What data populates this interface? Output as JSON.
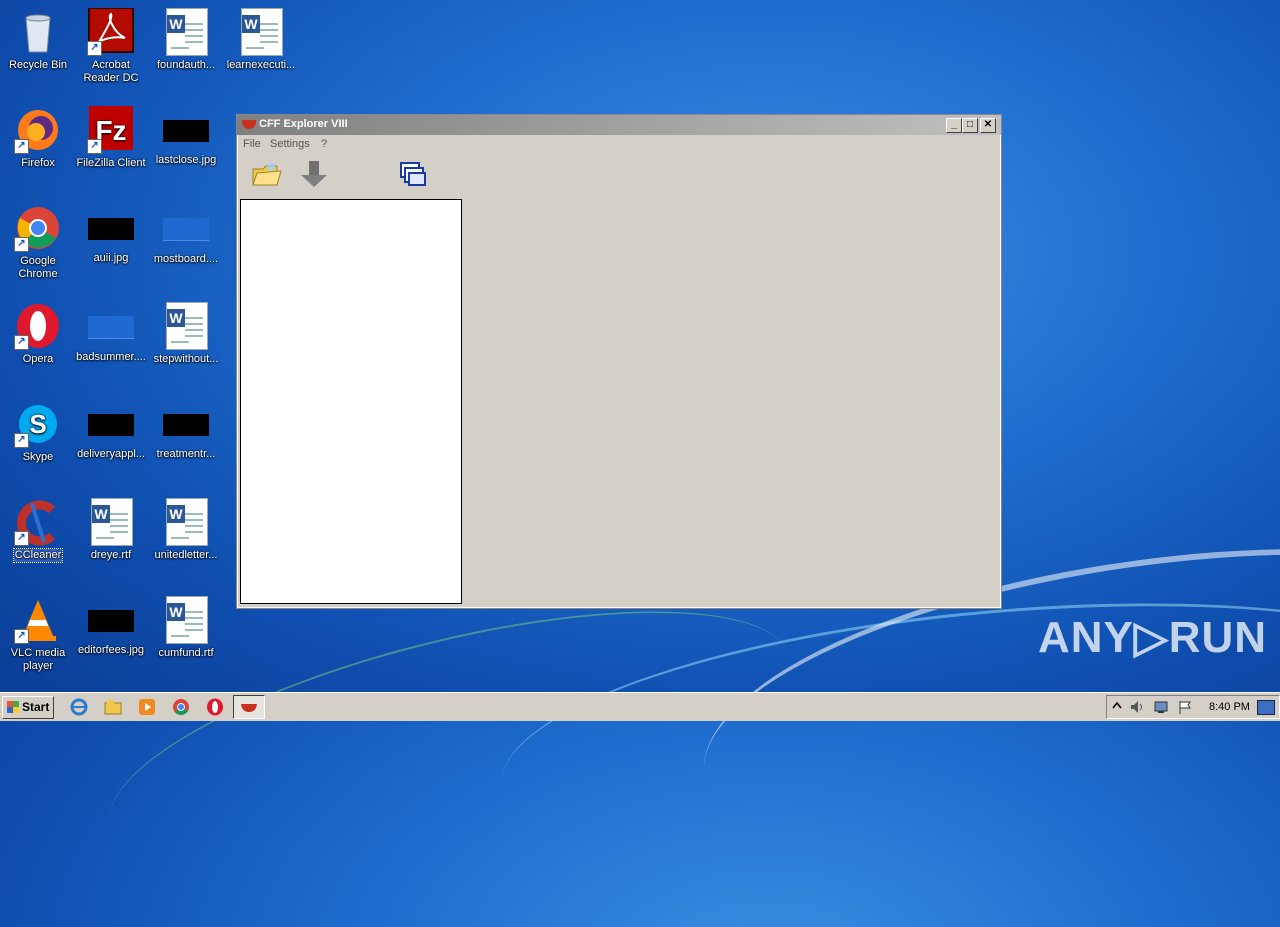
{
  "desktop": {
    "icons": [
      {
        "label": "Recycle Bin"
      },
      {
        "label": "Acrobat Reader DC"
      },
      {
        "label": "foundauth..."
      },
      {
        "label": "learnexecuti..."
      },
      {
        "label": "Firefox"
      },
      {
        "label": "FileZilla Client"
      },
      {
        "label": "lastclose.jpg"
      },
      {
        "label": "Google Chrome"
      },
      {
        "label": "auii.jpg"
      },
      {
        "label": "mostboard...."
      },
      {
        "label": "Opera"
      },
      {
        "label": "badsummer...."
      },
      {
        "label": "stepwithout..."
      },
      {
        "label": "Skype"
      },
      {
        "label": "deliveryappl..."
      },
      {
        "label": "treatmentr..."
      },
      {
        "label": "CCleaner"
      },
      {
        "label": "dreye.rtf"
      },
      {
        "label": "unitedletter..."
      },
      {
        "label": "VLC media player"
      },
      {
        "label": "editorfees.jpg"
      },
      {
        "label": "cumfund.rtf"
      }
    ]
  },
  "window": {
    "title": "CFF Explorer VIII",
    "menu": {
      "file": "File",
      "settings": "Settings",
      "help": "?"
    },
    "controls": {
      "minimize": "_",
      "maximize": "□",
      "close": "✕"
    }
  },
  "taskbar": {
    "start_label": "Start",
    "clock": "8:40 PM"
  },
  "watermark": "ANY▷RUN",
  "colors": {
    "desktop": "#1f6fd0",
    "window_bg": "#d4d0c8",
    "taskbar": "#d4d0c8"
  }
}
